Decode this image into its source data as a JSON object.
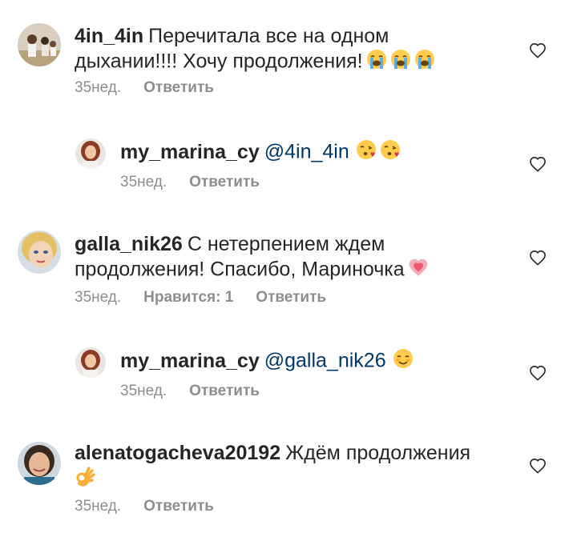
{
  "comments": [
    {
      "username": "4in_4in",
      "text": "Перечитала все на одном дыхании!!!! Хочу продолжения!",
      "emojis": [
        "loudly-crying-face",
        "loudly-crying-face",
        "loudly-crying-face"
      ],
      "time": "35нед.",
      "reply": "Ответить",
      "likes": ""
    },
    {
      "username": "my_marina_cy",
      "mention": "@4in_4in",
      "text": "",
      "emojis": [
        "face-blowing-kiss",
        "face-blowing-kiss"
      ],
      "time": "35нед.",
      "reply": "Ответить",
      "likes": ""
    },
    {
      "username": "galla_nik26",
      "text": "С нетерпением ждем продолжения! Спасибо, Мариночка",
      "emojis": [
        "growing-heart"
      ],
      "time": "35нед.",
      "reply": "Ответить",
      "likes": "Нравится: 1"
    },
    {
      "username": "my_marina_cy",
      "mention": "@galla_nik26",
      "text": "",
      "emojis": [
        "smiling-face"
      ],
      "time": "35нед.",
      "reply": "Ответить",
      "likes": ""
    },
    {
      "username": "alenatogacheva20192",
      "text": "Ждём продолжения",
      "emojis": [
        "ok-hand"
      ],
      "time": "35нед.",
      "reply": "Ответить",
      "likes": ""
    }
  ],
  "colors": {
    "text": "#262626",
    "meta": "#8e8e8e",
    "mention": "#00376b",
    "heart": "#262626"
  }
}
